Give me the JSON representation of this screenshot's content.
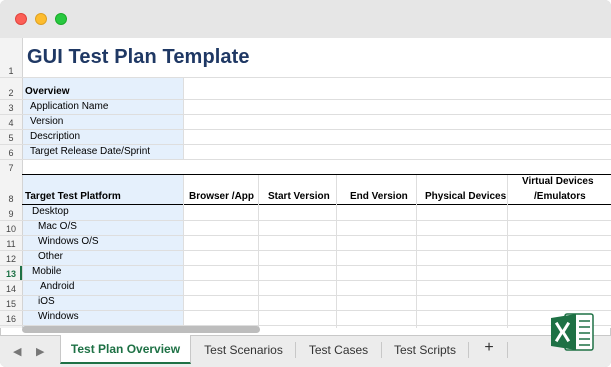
{
  "sheet": {
    "title": "GUI Test Plan Template",
    "row_numbers": [
      "1",
      "2",
      "3",
      "4",
      "5",
      "6",
      "7",
      "8",
      "9",
      "10",
      "11",
      "12",
      "13",
      "14",
      "15",
      "16"
    ],
    "overview": {
      "heading": "Overview",
      "items": [
        "Application Name",
        "Version",
        "Description",
        "Target Release Date/Sprint"
      ]
    },
    "platform_table": {
      "headers": [
        "Target Test Platform",
        "Browser /App",
        "Start Version",
        "End Version",
        "Physical Devices",
        "Virtual Devices",
        "/Emulators"
      ],
      "rows": [
        "Desktop",
        "Mac O/S",
        "Windows O/S",
        "Other",
        "Mobile",
        "Android",
        "iOS",
        "Windows"
      ]
    },
    "active_row": "13"
  },
  "tabs": {
    "items": [
      "Test Plan Overview",
      "Test Scenarios",
      "Test Cases",
      "Test Scripts"
    ],
    "active": "Test Plan Overview",
    "add_label": "+",
    "prev_label": "◀",
    "next_label": "▶"
  },
  "app": {
    "icon": "excel-icon",
    "accent": "#1e7145"
  }
}
